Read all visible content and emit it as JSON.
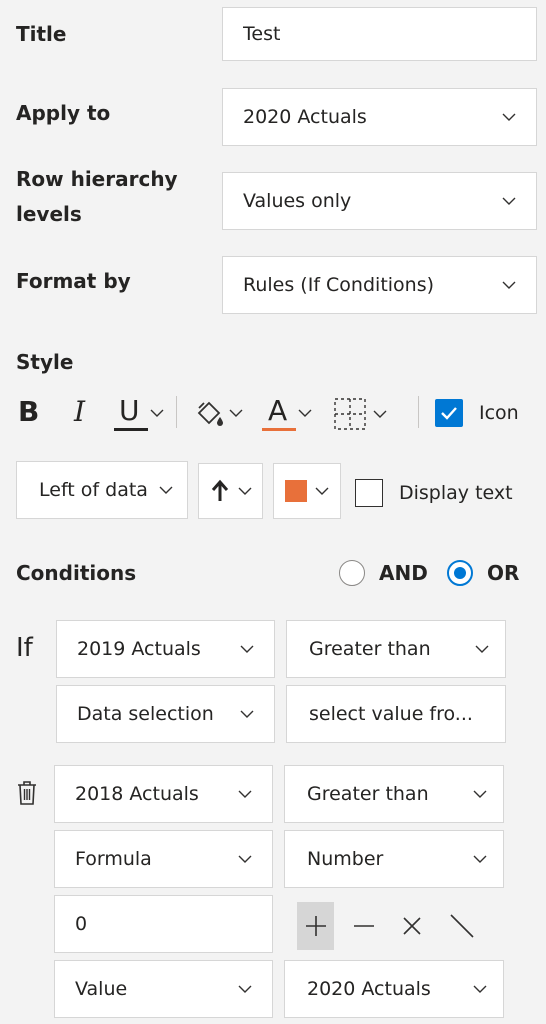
{
  "labels": {
    "title": "Title",
    "apply_to": "Apply to",
    "row_hierarchy_1": "Row hierarchy",
    "row_hierarchy_2": "levels",
    "format_by": "Format by",
    "style": "Style",
    "conditions": "Conditions",
    "if": "If"
  },
  "fields": {
    "title_value": "Test",
    "apply_to_value": "2020 Actuals",
    "row_hierarchy_value": "Values only",
    "format_by_value": "Rules (If Conditions)"
  },
  "style_toolbar": {
    "bold": "B",
    "italic": "I",
    "underline": "U",
    "font_color": "A",
    "icon_label": "Icon",
    "icon_checked": true
  },
  "icon_options": {
    "position": "Left of data",
    "display_text_label": "Display text",
    "display_text_checked": false,
    "icon_color": "#e8703a"
  },
  "logic": {
    "and_label": "AND",
    "or_label": "OR",
    "selected": "OR"
  },
  "condition1": {
    "field": "2019 Actuals",
    "operator": "Greater than",
    "value_type": "Data selection",
    "value": "select value fro..."
  },
  "condition2": {
    "field": "2018 Actuals",
    "operator": "Greater than",
    "value_type": "Formula",
    "value_kind": "Number",
    "number_value": "0",
    "operand_type": "Value",
    "operand": "2020 Actuals"
  },
  "colors": {
    "accent": "#0078d4",
    "underline_red": "#e8703a",
    "background": "#f3f3f3"
  }
}
